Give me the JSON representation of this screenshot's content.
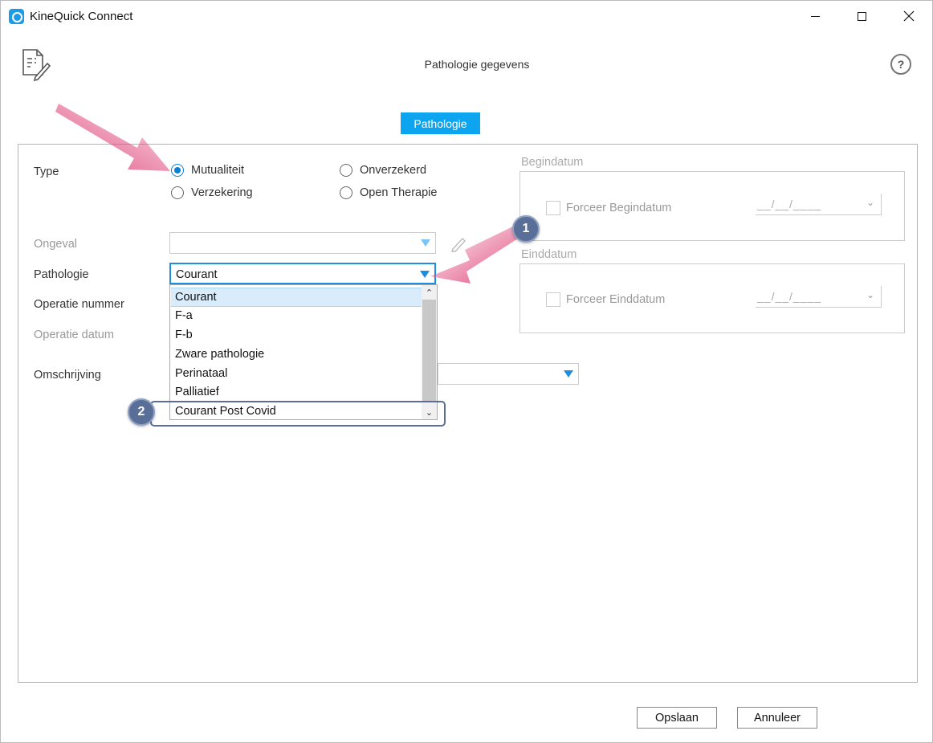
{
  "window": {
    "title": "KineQuick Connect"
  },
  "header": {
    "heading": "Pathologie gegevens",
    "help_symbol": "?"
  },
  "tabs": [
    {
      "label": "Pathologie",
      "active": true
    }
  ],
  "form": {
    "type_label": "Type",
    "type_options": [
      {
        "label": "Mutualiteit",
        "checked": true
      },
      {
        "label": "Onverzekerd",
        "checked": false
      },
      {
        "label": "Verzekering",
        "checked": false
      },
      {
        "label": "Open Therapie",
        "checked": false
      }
    ],
    "ongeval_label": "Ongeval",
    "ongeval_value": "",
    "pathologie_label": "Pathologie",
    "pathologie_value": "Courant",
    "operatie_nummer_label": "Operatie nummer",
    "operatie_datum_label": "Operatie datum",
    "omschrijving_label": "Omschrijving"
  },
  "pathologie_dropdown": {
    "options": [
      "Courant",
      "F-a",
      "F-b",
      "Zware pathologie",
      "Perinataal",
      "Palliatief",
      "Courant Post Covid"
    ],
    "selected": "Courant"
  },
  "begindatum": {
    "group_title": "Begindatum",
    "checkbox_label": "Forceer Begindatum",
    "date_value": "__/__/____"
  },
  "einddatum": {
    "group_title": "Einddatum",
    "checkbox_label": "Forceer Einddatum",
    "date_value": "__/__/____"
  },
  "footer": {
    "save_label": "Opslaan",
    "cancel_label": "Annuleer"
  },
  "annotations": {
    "badge_1": "1",
    "badge_2": "2",
    "arrow_color": "#e0457a",
    "badge_color": "#5a6f97"
  },
  "colors": {
    "accent": "#0ea5f0",
    "focus": "#1e8fe0"
  }
}
